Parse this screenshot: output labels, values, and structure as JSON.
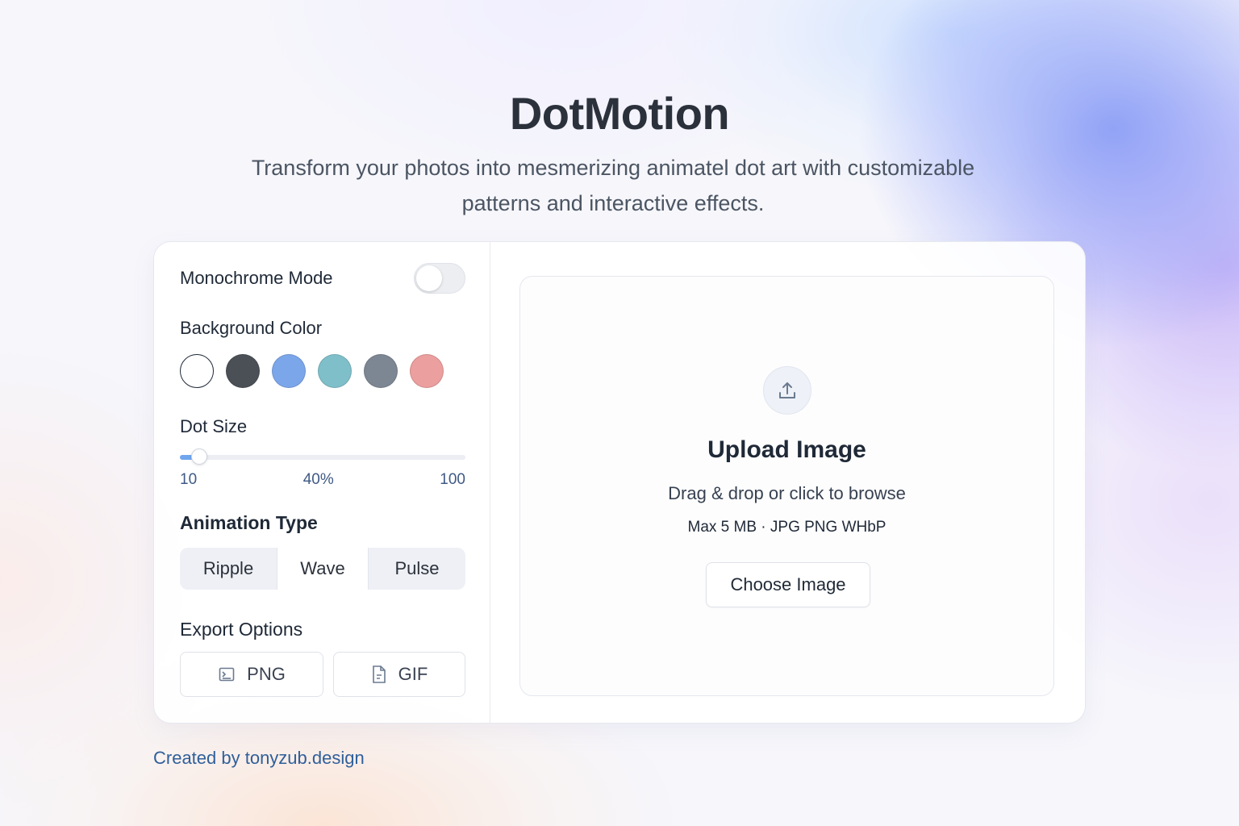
{
  "header": {
    "title": "DotMotion",
    "subtitle": "Transform your photos into mesmerizing animatel dot art with customizable patterns and interactive effects."
  },
  "controls": {
    "monochrome": {
      "label": "Monochrome Mode",
      "enabled": false
    },
    "background_color": {
      "label": "Background Color",
      "swatches": [
        {
          "name": "white",
          "color": "#ffffff",
          "selected": true
        },
        {
          "name": "charcoal",
          "color": "#4b5057"
        },
        {
          "name": "blue",
          "color": "#7ca6ea"
        },
        {
          "name": "teal",
          "color": "#7fbfc9"
        },
        {
          "name": "slate",
          "color": "#7d8793"
        },
        {
          "name": "rose",
          "color": "#eb9f9e"
        }
      ]
    },
    "dot_size": {
      "label": "Dot Size",
      "min_label": "10",
      "value_label": "40%",
      "max_label": "100",
      "min": 10,
      "max": 100,
      "value": 16
    },
    "animation_type": {
      "label": "Animation Type",
      "options": [
        "Ripple",
        "Wave",
        "Pulse"
      ],
      "selected": "Wave"
    },
    "export": {
      "label": "Export Options",
      "png_label": "PNG",
      "gif_label": "GIF",
      "png_icon": "image-icon",
      "gif_icon": "file-icon"
    }
  },
  "upload": {
    "icon": "upload-icon",
    "title": "Upload Image",
    "description": "Drag & drop or click to browse",
    "limits": "Max 5 MB · JPG  PNG WHbP",
    "button_label": "Choose Image"
  },
  "footer": {
    "credit": "Created by tonyzub.design"
  },
  "colors": {
    "accent": "#6fa6ee",
    "credit_link": "#2f5f9a"
  }
}
